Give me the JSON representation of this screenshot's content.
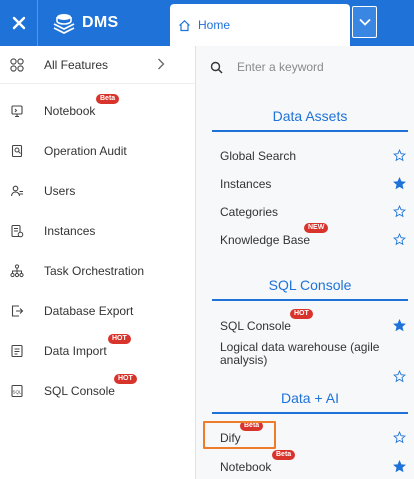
{
  "header": {
    "logo_text": "DMS",
    "home_tab": "Home"
  },
  "left_menu": {
    "all_features": "All Features",
    "items": [
      {
        "label": "Notebook",
        "badge": "Beta",
        "icon": "notebook-icon"
      },
      {
        "label": "Operation Audit",
        "badge": "",
        "icon": "audit-icon"
      },
      {
        "label": "Users",
        "badge": "",
        "icon": "users-icon"
      },
      {
        "label": "Instances",
        "badge": "",
        "icon": "instances-icon"
      },
      {
        "label": "Task Orchestration",
        "badge": "",
        "icon": "task-orchestration-icon"
      },
      {
        "label": "Database Export",
        "badge": "",
        "icon": "export-icon"
      },
      {
        "label": "Data Import",
        "badge": "HOT",
        "icon": "import-icon"
      },
      {
        "label": "SQL Console",
        "badge": "HOT",
        "icon": "sql-console-icon"
      }
    ]
  },
  "right_panel": {
    "search_placeholder": "Enter a keyword",
    "sections": [
      {
        "title": "Data Assets",
        "items": [
          {
            "label": "Global Search",
            "badge": "",
            "favorited": false
          },
          {
            "label": "Instances",
            "badge": "",
            "favorited": true
          },
          {
            "label": "Categories",
            "badge": "",
            "favorited": false
          },
          {
            "label": "Knowledge Base",
            "badge": "NEW",
            "favorited": false
          }
        ]
      },
      {
        "title": "SQL Console",
        "items": [
          {
            "label": "SQL Console",
            "badge": "HOT",
            "favorited": true
          },
          {
            "label": "Logical data warehouse (agile analysis)",
            "badge": "",
            "favorited": false
          }
        ]
      },
      {
        "title": "Data + AI",
        "items": [
          {
            "label": "Dify",
            "badge": "Beta",
            "favorited": false
          },
          {
            "label": "Notebook",
            "badge": "Beta",
            "favorited": true
          }
        ]
      }
    ]
  },
  "colors": {
    "brand_blue": "#1e72d8",
    "badge_red": "#d8342c",
    "highlight_orange": "#ed7d2a"
  }
}
